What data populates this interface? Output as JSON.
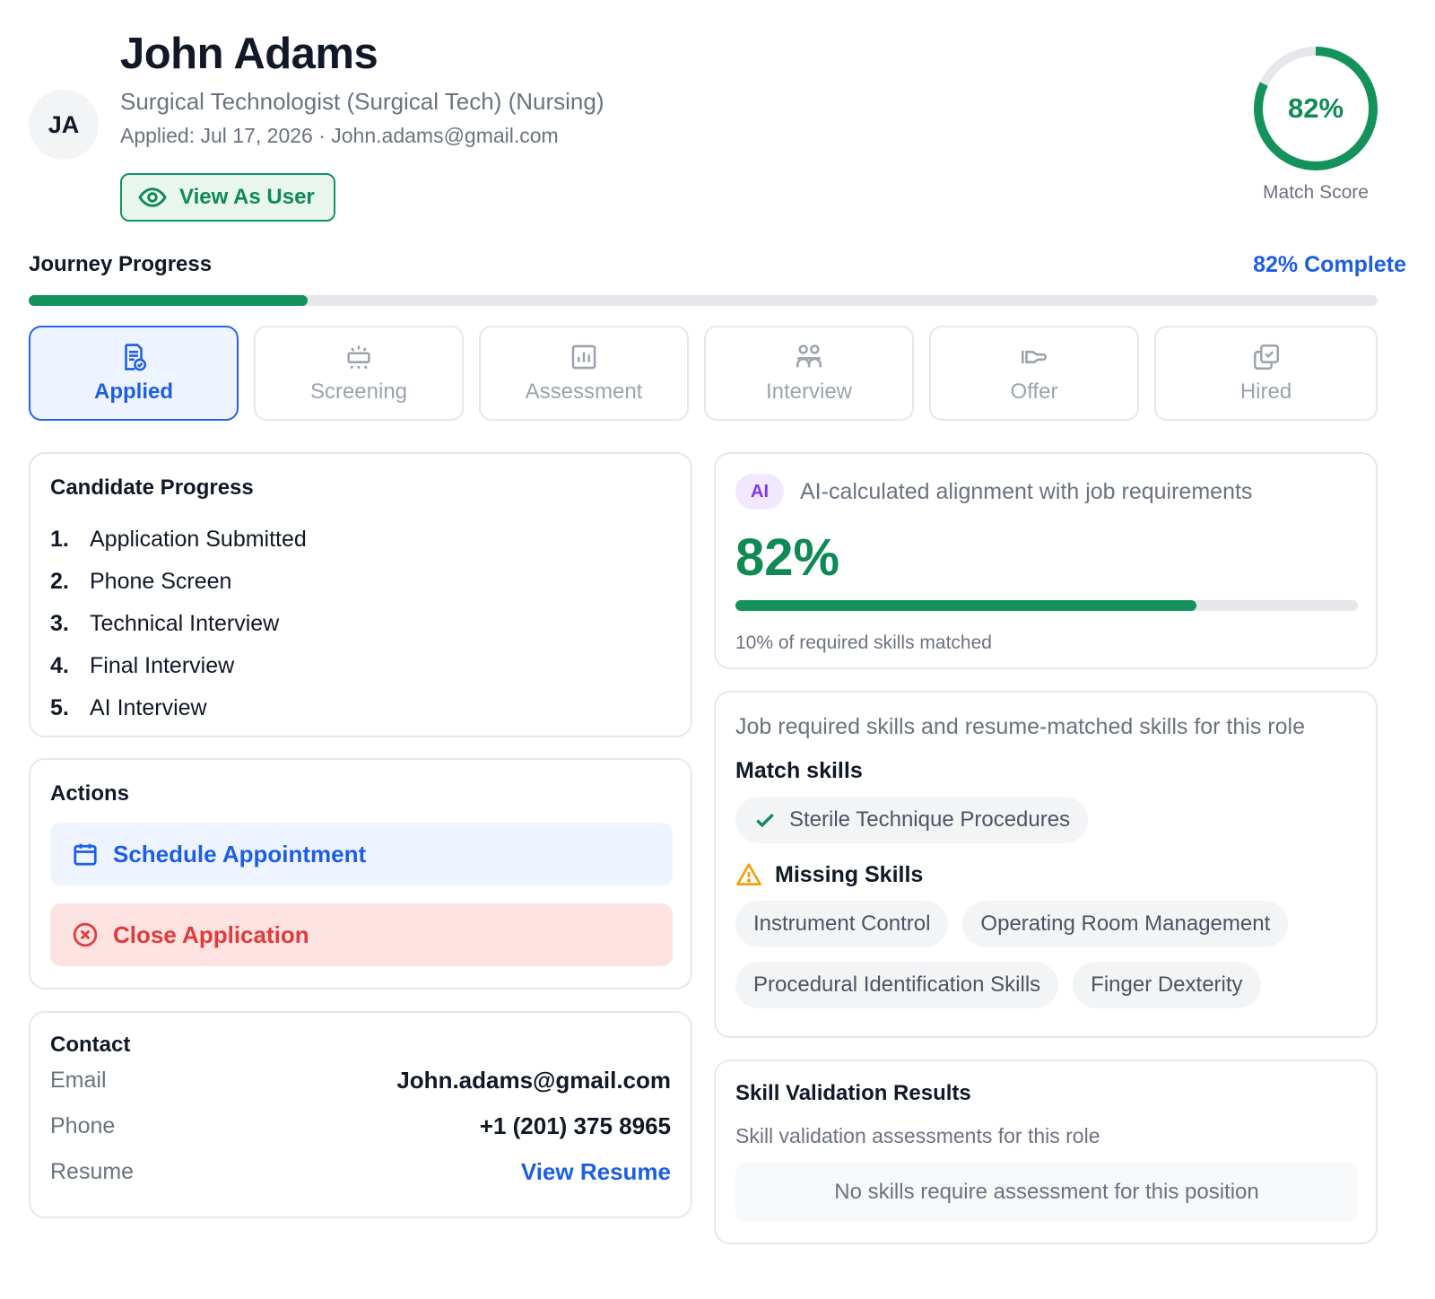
{
  "candidate": {
    "initials": "JA",
    "name": "John Adams",
    "role": "Surgical Technologist (Surgical Tech) (Nursing)",
    "applied_line": "Applied: Jul 17, 2026 · John.adams@gmail.com",
    "view_as_user_label": "View As User"
  },
  "match_score": {
    "value_text": "82%",
    "value": 82,
    "label": "Match Score"
  },
  "journey": {
    "title": "Journey Progress",
    "complete_text": "82% Complete",
    "progress_fraction": 0.207,
    "stages": [
      {
        "label": "Applied",
        "icon": "document-check-icon",
        "active": true
      },
      {
        "label": "Screening",
        "icon": "screening-monitor-icon",
        "active": false
      },
      {
        "label": "Assessment",
        "icon": "bar-chart-icon",
        "active": false
      },
      {
        "label": "Interview",
        "icon": "people-icon",
        "active": false
      },
      {
        "label": "Offer",
        "icon": "handshake-icon",
        "active": false
      },
      {
        "label": "Hired",
        "icon": "copy-check-icon",
        "active": false
      }
    ]
  },
  "candidate_progress": {
    "title": "Candidate Progress",
    "steps": [
      {
        "num": "1.",
        "label": "Application Submitted"
      },
      {
        "num": "2.",
        "label": "Phone Screen"
      },
      {
        "num": "3.",
        "label": "Technical Interview"
      },
      {
        "num": "4.",
        "label": "Final Interview"
      },
      {
        "num": "5.",
        "label": "AI Interview"
      }
    ]
  },
  "actions": {
    "title": "Actions",
    "schedule_label": "Schedule Appointment",
    "close_label": "Close Application"
  },
  "contact": {
    "title": "Contact",
    "email_key": "Email",
    "email_value": "John.adams@gmail.com",
    "phone_key": "Phone",
    "phone_value": "+1 (201) 375 8965",
    "resume_key": "Resume",
    "resume_link": "View Resume"
  },
  "ai_alignment": {
    "badge": "AI",
    "description": "AI-calculated alignment with job requirements",
    "value_text": "82%",
    "bar_fraction": 0.74,
    "note": "10% of required skills matched"
  },
  "skills": {
    "description": "Job required skills and resume-matched skills for this role",
    "match_title": "Match skills",
    "matched": [
      "Sterile Technique Procedures"
    ],
    "missing_title": "Missing Skills",
    "missing": [
      "Instrument Control",
      "Operating Room Management",
      "Procedural Identification Skills",
      "Finger Dexterity"
    ]
  },
  "validation": {
    "title": "Skill Validation Results",
    "description": "Skill validation assessments for this role",
    "empty_text": "No skills require assessment for this position"
  },
  "colors": {
    "accent_green": "#13925c",
    "accent_blue": "#1d5ee4",
    "danger_red": "#e23b3b",
    "ai_purple": "#7c3aed",
    "warning_orange": "#f59e0b"
  }
}
